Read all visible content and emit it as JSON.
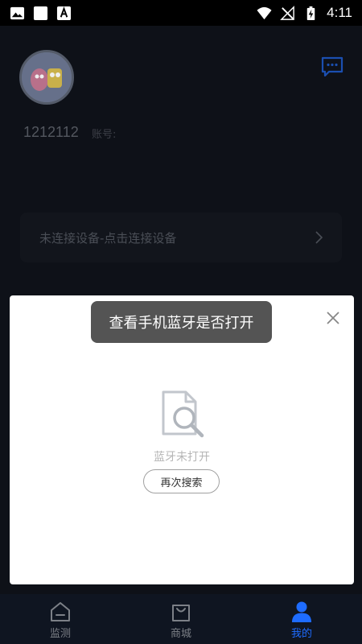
{
  "status_bar": {
    "time": "4:11",
    "icons": [
      "image-icon",
      "square-icon",
      "font-icon",
      "wifi-icon",
      "no-signal-icon",
      "battery-charging-icon"
    ]
  },
  "profile": {
    "user_id": "1212112",
    "account_label": "账号:"
  },
  "device": {
    "connect_text": "未连接设备-点击连接设备"
  },
  "modal": {
    "empty_text": "蓝牙未打开",
    "retry_label": "再次搜索"
  },
  "toast": {
    "text": "查看手机蓝牙是否打开"
  },
  "bottom_nav": {
    "items": [
      {
        "label": "监测",
        "icon": "monitor-icon"
      },
      {
        "label": "商城",
        "icon": "shopping-bag-icon"
      },
      {
        "label": "我的",
        "icon": "person-icon"
      }
    ],
    "active_index": 2
  },
  "colors": {
    "accent": "#1e6cff",
    "overlay": "#0e1118"
  }
}
